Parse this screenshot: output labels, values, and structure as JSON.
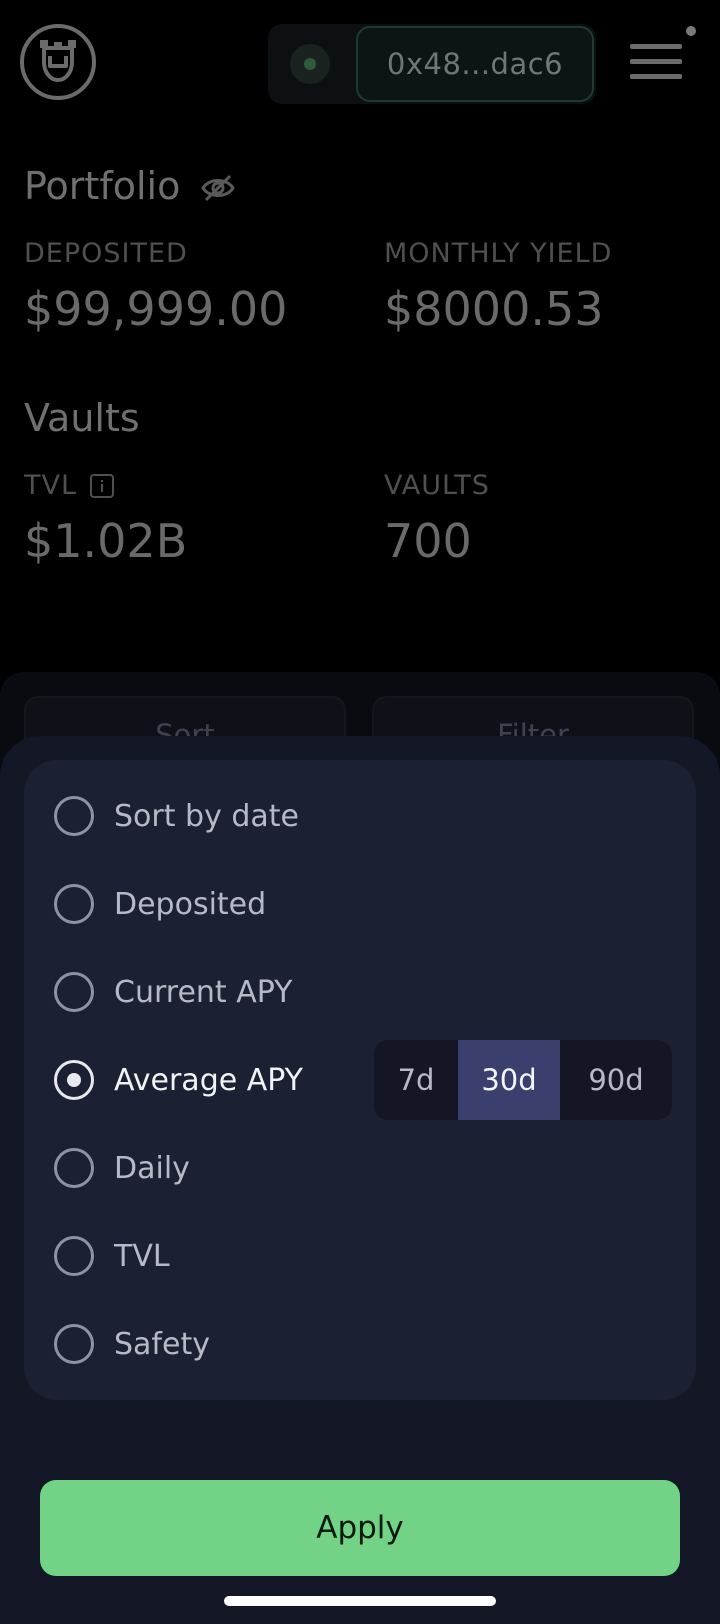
{
  "header": {
    "wallet_address": "0x48...dac6"
  },
  "portfolio": {
    "title": "Portfolio",
    "deposited_label": "DEPOSITED",
    "deposited_value": "$99,999.00",
    "monthly_yield_label": "MONTHLY YIELD",
    "monthly_yield_value": "$8000.53"
  },
  "vaults": {
    "title": "Vaults",
    "tvl_label": "TVL",
    "tvl_value": "$1.02B",
    "vaults_label": "VAULTS",
    "vaults_value": "700"
  },
  "toolbar": {
    "sort_label": "Sort",
    "filter_label": "Filter"
  },
  "sort_sheet": {
    "options": [
      {
        "label": "Sort by date",
        "selected": false
      },
      {
        "label": "Deposited",
        "selected": false
      },
      {
        "label": "Current APY",
        "selected": false
      },
      {
        "label": "Average APY",
        "selected": true
      },
      {
        "label": "Daily",
        "selected": false
      },
      {
        "label": "TVL",
        "selected": false
      },
      {
        "label": "Safety",
        "selected": false
      }
    ],
    "periods": [
      "7d",
      "30d",
      "90d"
    ],
    "selected_period": "30d",
    "apply_label": "Apply"
  },
  "colors": {
    "accent_green": "#72d285",
    "sheet_bg": "#131726",
    "card_bg": "#1c2033",
    "segment_active": "#3a3f6e"
  },
  "icons": {
    "logo": "giraffe-logo-icon",
    "hide_balance": "eye-off-icon",
    "info": "info-icon",
    "menu": "hamburger-menu-icon"
  }
}
